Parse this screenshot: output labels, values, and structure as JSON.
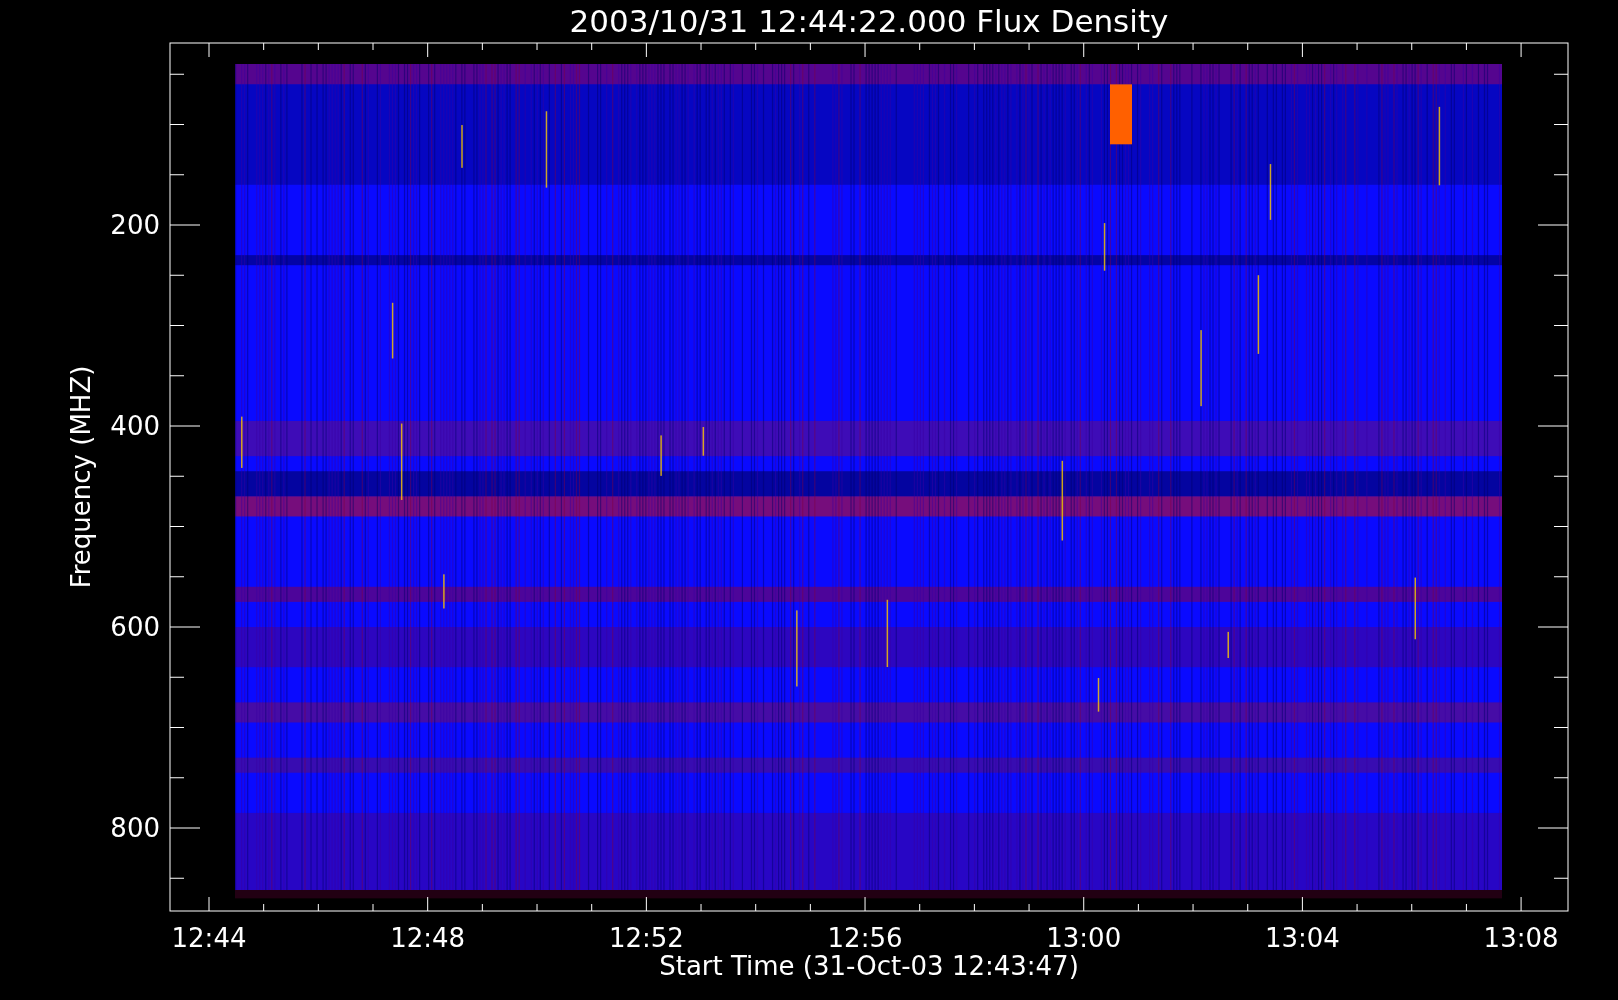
{
  "title": "2003/10/31 12:44:22.000 Flux Density",
  "xlabel": "Start Time (31-Oct-03 12:43:47)",
  "ylabel": "Frequency (MHZ)",
  "xticks": [
    "12:44",
    "12:48",
    "12:52",
    "12:56",
    "13:00",
    "13:04",
    "13:08"
  ],
  "yticks": [
    "200",
    "400",
    "600",
    "800"
  ]
}
